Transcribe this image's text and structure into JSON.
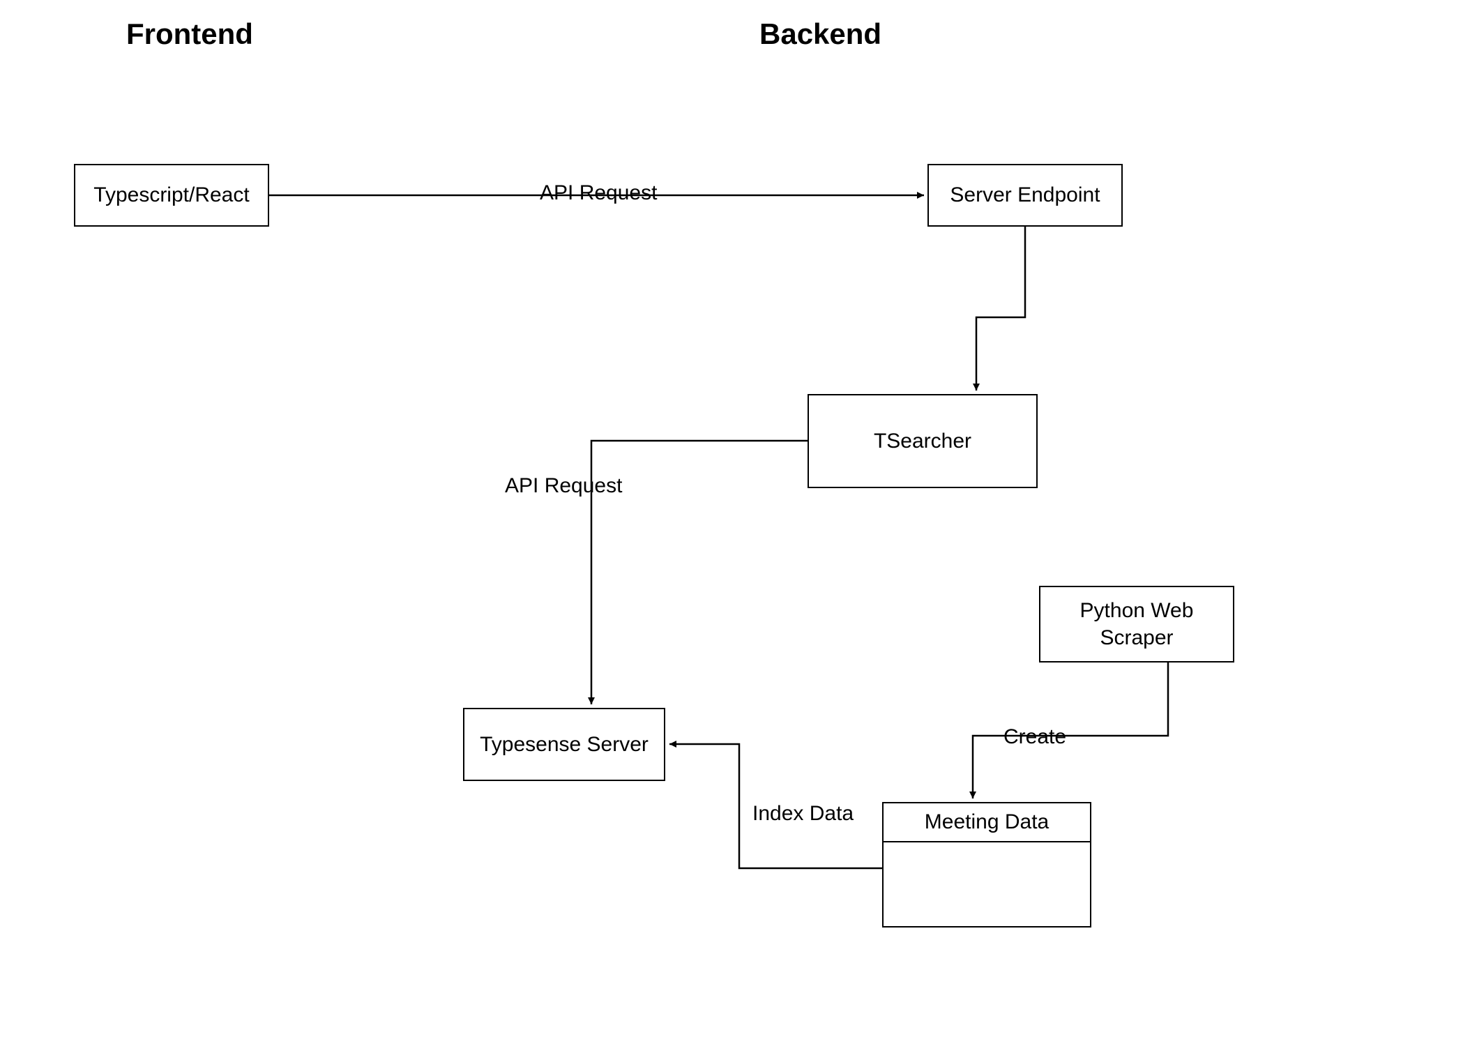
{
  "sections": {
    "frontend": "Frontend",
    "backend": "Backend"
  },
  "nodes": {
    "typescript_react": "Typescript/React",
    "server_endpoint": "Server Endpoint",
    "tsearcher": "TSearcher",
    "typesense_server": "Typesense Server",
    "python_web_scraper": "Python Web\nScraper",
    "meeting_data": "Meeting Data"
  },
  "edges": {
    "api_request_1": "API Request",
    "api_request_2": "API Request",
    "index_data": "Index Data",
    "create": "Create"
  }
}
